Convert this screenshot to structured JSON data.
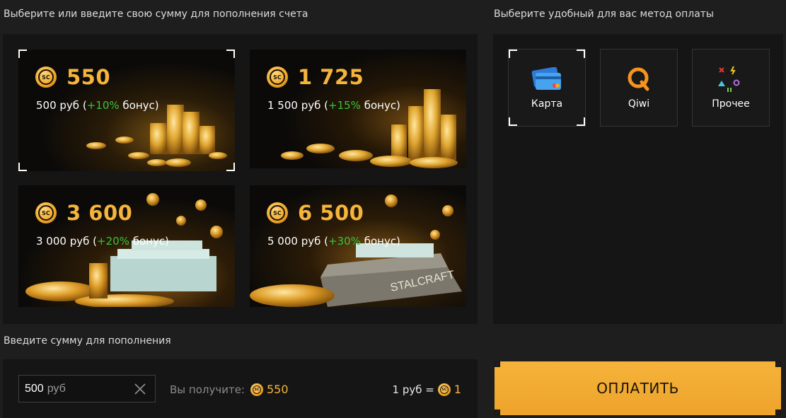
{
  "packages_heading": "Выберите или введите свою сумму для пополнения счета",
  "methods_heading": "Выберите удобный для вас метод оплаты",
  "coin_icon_text": "SC",
  "packages": [
    {
      "amount": "550",
      "price": "500 руб",
      "bonus_open": "(",
      "bonus": "+10%",
      "bonus_word": "бонус)",
      "selected": true
    },
    {
      "amount": "1 725",
      "price": "1 500 руб",
      "bonus_open": "(",
      "bonus": "+15%",
      "bonus_word": "бонус)",
      "selected": false
    },
    {
      "amount": "3 600",
      "price": "3 000 руб",
      "bonus_open": "(",
      "bonus": "+20%",
      "bonus_word": "бонус)",
      "selected": false
    },
    {
      "amount": "6 500",
      "price": "5 000 руб",
      "bonus_open": "(",
      "bonus": "+30%",
      "bonus_word": "бонус)",
      "selected": false
    }
  ],
  "payment_methods": [
    {
      "label": "Карта",
      "icon": "credit-card-icon",
      "selected": true
    },
    {
      "label": "Qiwi",
      "icon": "qiwi-icon",
      "selected": false
    },
    {
      "label": "Прочее",
      "icon": "other-methods-icon",
      "selected": false
    }
  ],
  "custom_amount": {
    "heading": "Введите сумму для пополнения",
    "value": "500",
    "unit": "руб",
    "you_get_label": "Вы получите:",
    "you_get_value": "550",
    "rate_left": "1 руб =",
    "rate_right": "1"
  },
  "pay_button_label": "ОПЛАТИТЬ",
  "colors": {
    "accent": "#f5b43c",
    "bonus": "#36c53a",
    "pay": "#f2ab33"
  }
}
